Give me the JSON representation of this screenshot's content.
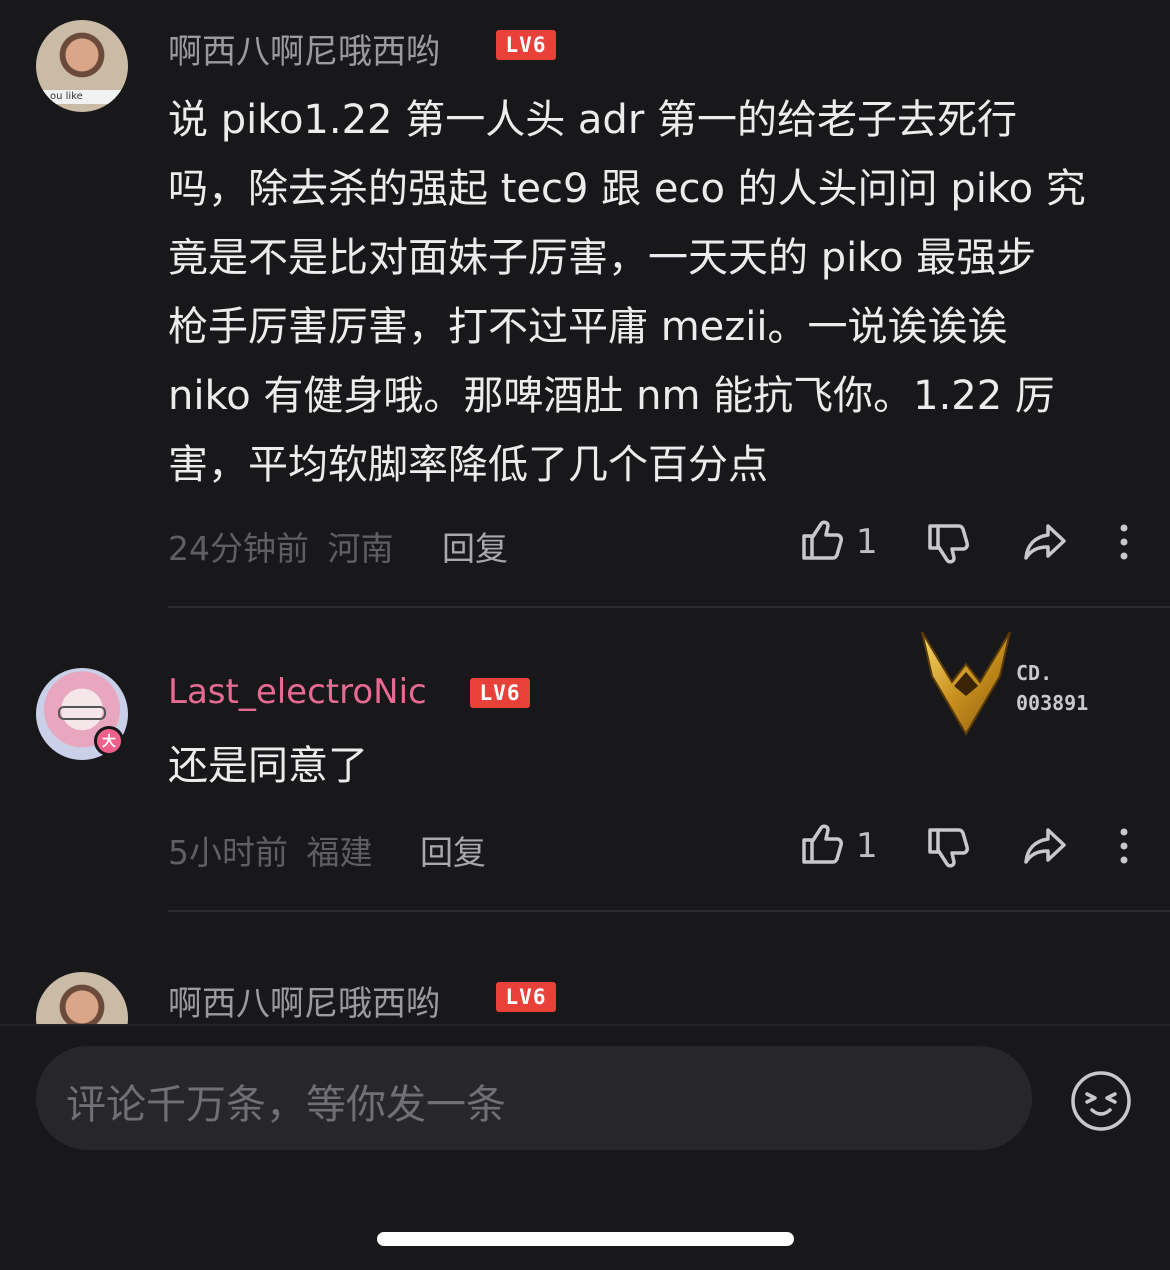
{
  "comments": [
    {
      "username": "啊西八啊尼哦西哟",
      "level": "LV6",
      "lines": [
        "说 piko1.22 第一人头 adr 第一的给老子去死行",
        "吗，除去杀的强起 tec9 跟 eco 的人头问问 piko 究",
        "竟是不是比对面妹子厉害，一天天的 piko 最强步",
        "枪手厉害厉害，打不过平庸 mezii。一说诶诶诶",
        " niko 有健身哦。那啤酒肚 nm 能抗飞你。1.22 厉",
        "害，平均软脚率降低了几个百分点"
      ],
      "time": "24分钟前",
      "location": "河南",
      "reply_label": "回复",
      "likes": "1"
    },
    {
      "username": "Last_electroNic",
      "level": "LV6",
      "avatar_badge": "大",
      "pendant_code": [
        "CD.",
        "003891"
      ],
      "lines": [
        "还是同意了"
      ],
      "time": "5小时前",
      "location": "福建",
      "reply_label": "回复",
      "likes": "1"
    },
    {
      "username": "啊西八啊尼哦西哟",
      "level": "LV6"
    }
  ],
  "avatar_caption": "ou like",
  "composer": {
    "placeholder": "评论千万条，等你发一条",
    "emoji_icon": "emoji-face-icon"
  },
  "colors": {
    "background": "#18181b",
    "level_badge": "#e8413a",
    "pink_username": "#e86a93"
  }
}
